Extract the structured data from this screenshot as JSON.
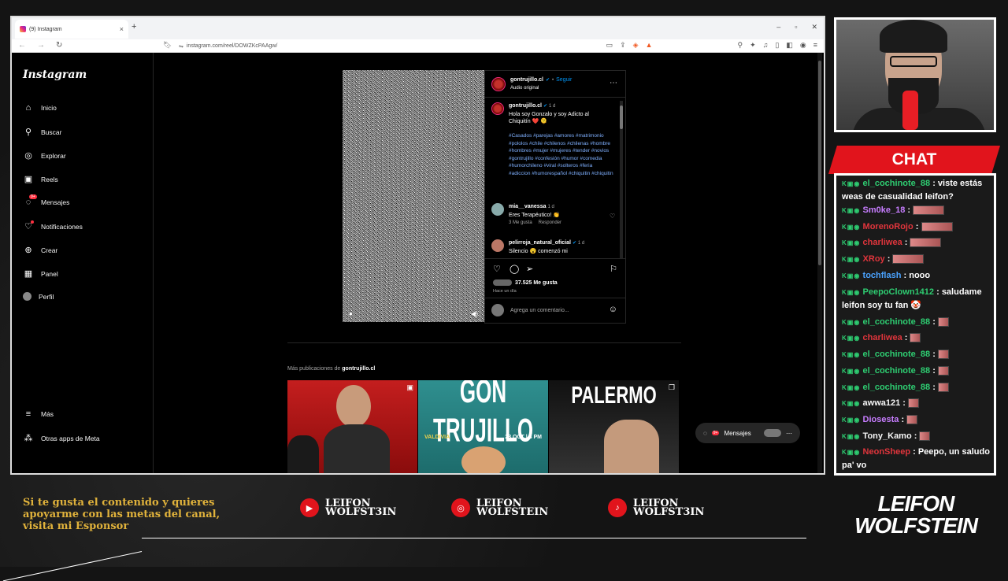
{
  "browser": {
    "tab_title": "(9) Instagram",
    "url": "instagram.com/reel/DOWZKcPAAgw/",
    "new_tab": "+"
  },
  "instagram": {
    "logo": "Instagram",
    "sidebar": [
      {
        "label": "Inicio",
        "icon": "home-icon"
      },
      {
        "label": "Buscar",
        "icon": "search-icon"
      },
      {
        "label": "Explorar",
        "icon": "compass-icon"
      },
      {
        "label": "Reels",
        "icon": "reels-icon"
      },
      {
        "label": "Mensajes",
        "icon": "messenger-icon",
        "badge": "9+"
      },
      {
        "label": "Notificaciones",
        "icon": "heart-icon"
      },
      {
        "label": "Crear",
        "icon": "plus-icon"
      },
      {
        "label": "Panel",
        "icon": "dashboard-icon"
      },
      {
        "label": "Perfil",
        "icon": "avatar"
      }
    ],
    "more_label": "Más",
    "meta_label": "Otras apps de Meta",
    "post": {
      "username": "gontrujillo.cl",
      "follow": "Seguir",
      "audio": "Audio original",
      "caption_user": "gontrujillo.cl",
      "caption_time": "1 d",
      "caption": "Hola soy Gonzalo y soy Adicto al Chiquitín ❤️ 🫠",
      "hashtags": "#Casados #parejas #amores #matrimonio #pololos #chile #chilenos #chilenas #hombre #hombres #mujer #mujeres #tender #novios #gontrujillo #confesión #humor #comedia #humorchileno #viral #solteros #feria #adiccion #humorespañol #chiquitin #chiquitin",
      "c1_user": "mia__vanessa",
      "c1_time": "1 d",
      "c1_text": "Eres Terapéutico! 👏",
      "c1_likes": "3 Me gusta",
      "c1_reply": "Responder",
      "c2_user": "pelirroja_natural_oficial",
      "c2_time": "1 d",
      "c2_text": "Silencio 😮 comenzó mi",
      "likes": "37.525 Me gusta",
      "time_ago": "Hace un día",
      "comment_placeholder": "Agrega un comentario..."
    },
    "more_posts_prefix": "Más publicaciones de",
    "more_posts_user": "gontrujillo.cl",
    "thumbs": [
      {
        "title": ""
      },
      {
        "title": "GON TRUJILLO",
        "sub": "VALDIVIA",
        "date": "23 OCT | 8 PM"
      },
      {
        "title": "PALERMO"
      }
    ],
    "messages_label": "Mensajes",
    "messages_badge": "9+"
  },
  "chat": {
    "header": "CHAT",
    "lines": [
      {
        "user": "el_cochinote_88",
        "color": "#2ecc71",
        "msg": "viste estás weas de casualidad leifon?"
      },
      {
        "user": "Sm0ke_18",
        "color": "#c77dff",
        "msg": ""
      },
      {
        "user": "MorenoRojo",
        "color": "#e0353c",
        "msg": ""
      },
      {
        "user": "charliwea",
        "color": "#e0353c",
        "msg": ""
      },
      {
        "user": "XRoy",
        "color": "#e0353c",
        "msg": ""
      },
      {
        "user": "tochflash",
        "color": "#4aa3ff",
        "msg": "nooo"
      },
      {
        "user": "PeepoClown1412",
        "color": "#2ecc71",
        "msg": "saludame leifon soy tu fan 🤡"
      },
      {
        "user": "el_cochinote_88",
        "color": "#2ecc71",
        "msg": ""
      },
      {
        "user": "charliwea",
        "color": "#e0353c",
        "msg": ""
      },
      {
        "user": "el_cochinote_88",
        "color": "#2ecc71",
        "msg": ""
      },
      {
        "user": "el_cochinote_88",
        "color": "#2ecc71",
        "msg": ""
      },
      {
        "user": "el_cochinote_88",
        "color": "#2ecc71",
        "msg": ""
      },
      {
        "user": "awwa121",
        "color": "#f5f5f5",
        "msg": ""
      },
      {
        "user": "Diosesta",
        "color": "#c77dff",
        "msg": ""
      },
      {
        "user": "Tony_Kamo",
        "color": "#f5f5f5",
        "msg": ""
      },
      {
        "user": "NeonSheep",
        "color": "#e0353c",
        "msg": "Peepo, un saludo pa' vo"
      }
    ]
  },
  "overlay": {
    "promo": "Si te gusta el contenido y quieres apoyarme con las metas del canal, visita mi Esponsor",
    "youtube": "LEIFON WOLFST3IN",
    "instagram": "LEIFON WOLFSTEIN",
    "tiktok": "LEIFON WOLFST3IN",
    "brand_line1": "LEIFON",
    "brand_line2": "WOLFSTEIN"
  }
}
